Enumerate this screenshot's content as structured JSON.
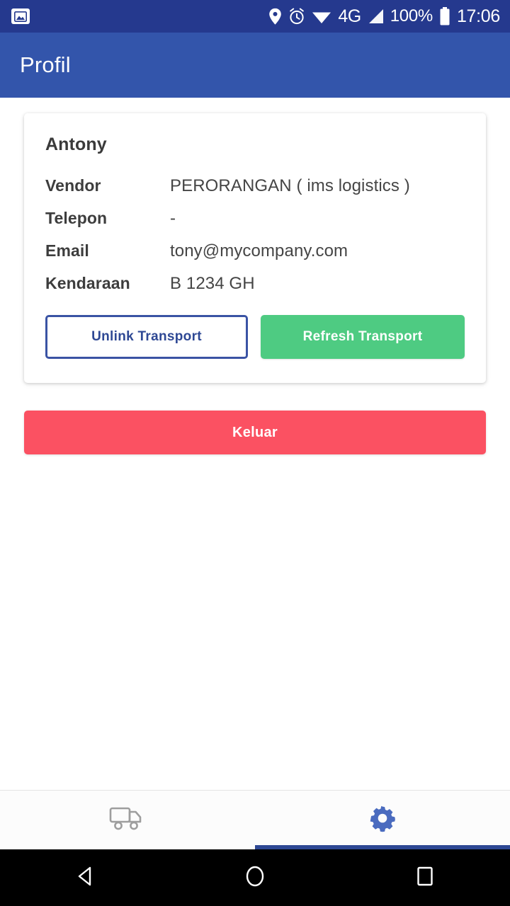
{
  "status_bar": {
    "background_color": "#25398E",
    "left_icon": "photo-icon",
    "icons": [
      "location-pin-icon",
      "alarm-icon",
      "wifi-icon",
      "signal-bars-icon"
    ],
    "network_label": "4G",
    "battery_percent": "100%",
    "battery_icon": "battery-full-icon",
    "clock": "17:06"
  },
  "app_bar": {
    "title": "Profil",
    "background_color": "#3355AB"
  },
  "profile_card": {
    "name": "Antony",
    "rows": [
      {
        "label": "Vendor",
        "value": "PERORANGAN ( ims logistics )"
      },
      {
        "label": "Telepon",
        "value": "-"
      },
      {
        "label": "Email",
        "value": "tony@mycompany.com"
      },
      {
        "label": "Kendaraan",
        "value": "B 1234 GH"
      }
    ],
    "unlink_label": "Unlink Transport",
    "refresh_label": "Refresh Transport",
    "unlink_color": "#2E4894",
    "refresh_color": "#4ECB82"
  },
  "logout": {
    "label": "Keluar",
    "color": "#FB5162"
  },
  "tab_bar": {
    "tabs": [
      {
        "name": "transport",
        "icon": "truck-icon",
        "active": false,
        "color": "#9E9E9E"
      },
      {
        "name": "settings",
        "icon": "gear-icon",
        "active": true,
        "color": "#4A6BBF"
      }
    ],
    "indicator_color": "#2E4894"
  },
  "nav_bar": {
    "buttons": [
      "back-icon",
      "home-icon",
      "recents-icon"
    ]
  }
}
